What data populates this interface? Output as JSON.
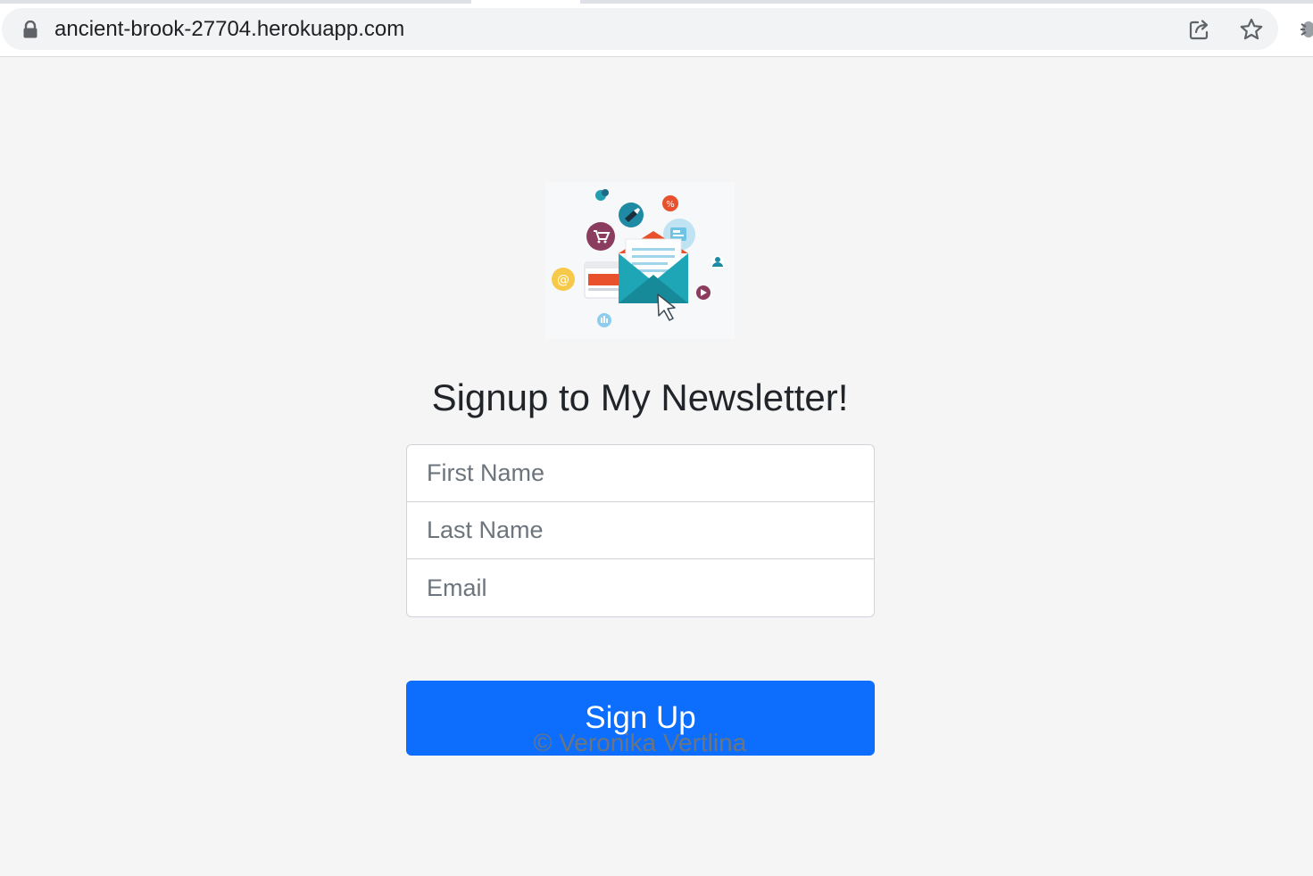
{
  "browser": {
    "url": "ancient-brook-27704.herokuapp.com",
    "icons": [
      "lock-icon",
      "share-icon",
      "star-icon",
      "extension-icon"
    ]
  },
  "hero": {
    "image": "newsletter-illustration"
  },
  "headline": "Signup to My Newsletter!",
  "form": {
    "first_name_placeholder": "First Name",
    "last_name_placeholder": "Last Name",
    "email_placeholder": "Email",
    "submit_label": "Sign Up"
  },
  "footer": {
    "copyright": "© Veronika Vertlina"
  },
  "colors": {
    "primary": "#0d6efd",
    "background": "#f5f5f5",
    "text": "#212529",
    "muted": "#6c757d"
  }
}
